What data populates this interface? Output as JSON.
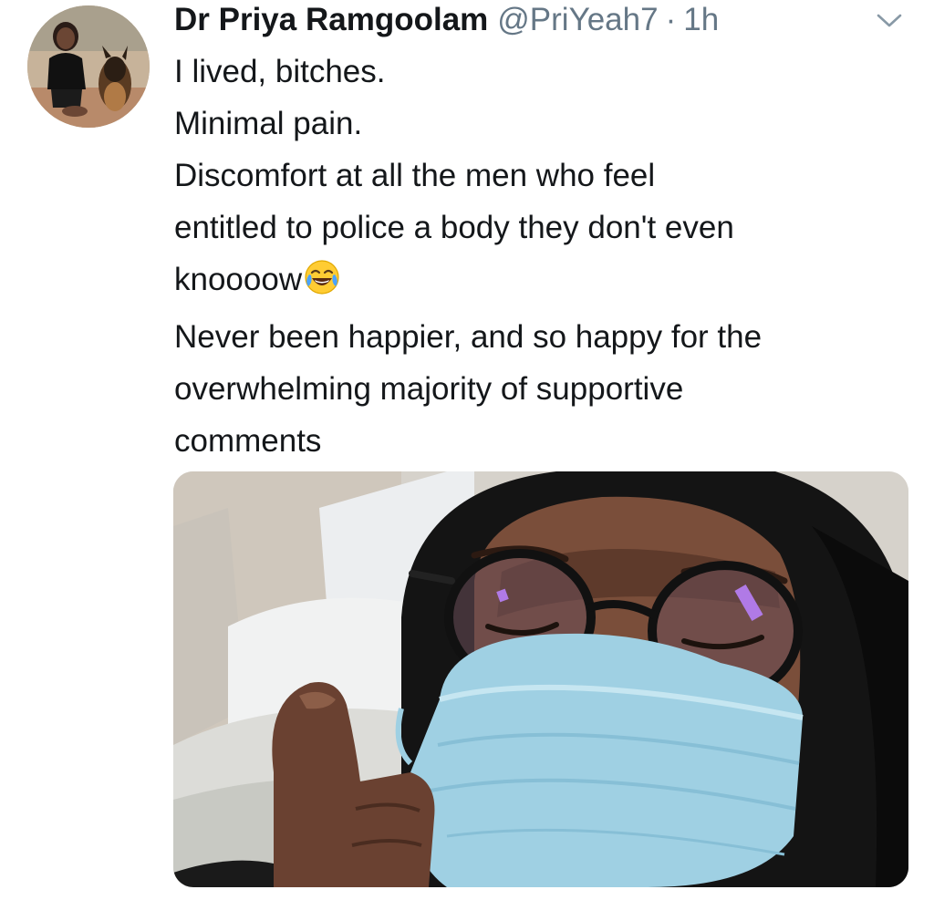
{
  "tweet": {
    "author": {
      "display_name": "Dr Priya Ramgoolam",
      "handle": "@PriYeah7",
      "separator": "·",
      "time": "1h"
    },
    "lines": [
      "I lived, bitches.",
      "Minimal pain.",
      "Discomfort at all the men who feel",
      "entitled to police a body they don't even",
      "knoooow",
      "Never been happier, and so happy for the",
      "overwhelming majority of supportive",
      "comments"
    ],
    "emoji": "face-with-tears-of-joy",
    "icons": {
      "menu": "chevron-down-icon"
    },
    "colors": {
      "text": "#14171a",
      "secondary": "#657786",
      "mask": "#9fd0e3"
    }
  }
}
